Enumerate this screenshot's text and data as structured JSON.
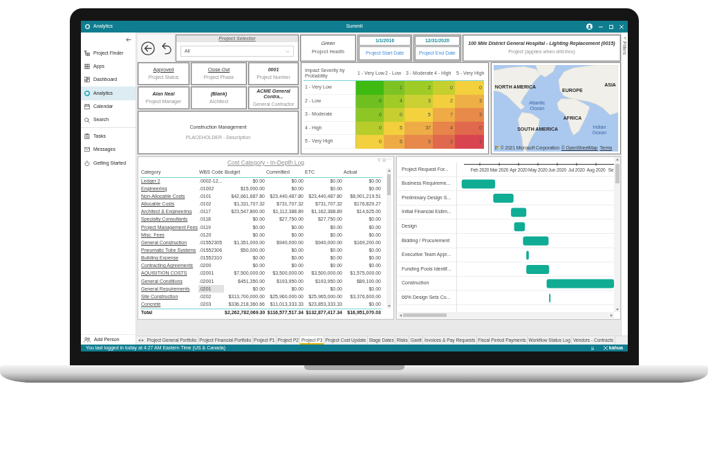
{
  "window": {
    "app_title": "Analytics",
    "title": "Summit"
  },
  "sidebar": {
    "groups": [
      [
        {
          "label": "Project Finder",
          "selected": false
        },
        {
          "label": "Apps",
          "selected": false
        },
        {
          "label": "Dashboard",
          "selected": false
        },
        {
          "label": "Analytics",
          "selected": true
        },
        {
          "label": "Calendar",
          "selected": false
        },
        {
          "label": "Search",
          "selected": false
        }
      ],
      [
        {
          "label": "Tasks",
          "selected": false
        },
        {
          "label": "Messages",
          "selected": false
        },
        {
          "label": "Getting Started",
          "selected": false
        }
      ]
    ],
    "footer_item": {
      "label": "Add Person"
    }
  },
  "project_selector": {
    "title": "Project Selector",
    "value": "All"
  },
  "kpis": [
    {
      "kind": "status",
      "value": "Green",
      "label": "Project Health"
    },
    {
      "kind": "date",
      "value": "1/1/2016",
      "label": "Project Start Date"
    },
    {
      "kind": "date",
      "value": "12/31/2020",
      "label": "Project End Date"
    },
    {
      "kind": "project",
      "value": "100 Mile District General Hospital - Lighting Replacement (0015)",
      "label": "Project (applies when drill-thru)"
    }
  ],
  "filters_pane": {
    "label": "Filters"
  },
  "project_cards": [
    {
      "kind": "link",
      "value": "Approved",
      "label": "Project Status"
    },
    {
      "kind": "link",
      "value": "Close-Out",
      "label": "Project Phase"
    },
    {
      "kind": "field",
      "value": "0001",
      "label": "Project Number"
    },
    {
      "kind": "field",
      "value": "Alan Neal",
      "label": "Project Manager"
    },
    {
      "kind": "field",
      "value": "(Blank)",
      "label": "Architect"
    },
    {
      "kind": "field",
      "value": "ACME General Contra...",
      "label": "General Contractor"
    }
  ],
  "description_card": {
    "title": "Construction Management",
    "subtitle": "PLACEHOLDER - Description"
  },
  "risk_matrix": {
    "title": "Impact Severity by Probability",
    "columns": [
      "1 - Very Low",
      "2 - Low",
      "3 - Moderate",
      "4 - High",
      "5 - Very High"
    ],
    "rows": [
      {
        "label": "1 - Very Low",
        "cells": [
          {
            "color": "#3fba12"
          },
          {
            "value": "1",
            "color": "#7ec324"
          },
          {
            "value": "2",
            "color": "#9fcb26"
          },
          {
            "value": "0",
            "color": "#c5cf2e"
          },
          {
            "value": "0",
            "color": "#f3d03c"
          }
        ]
      },
      {
        "label": "2 - Low",
        "cells": [
          {
            "value": "0",
            "color": "#6fbf20"
          },
          {
            "value": "4",
            "color": "#a0cb27"
          },
          {
            "value": "3",
            "color": "#cbd033"
          },
          {
            "value": "2",
            "color": "#f3cf3d"
          },
          {
            "value": "3",
            "color": "#eeb046"
          }
        ]
      },
      {
        "label": "3 - Moderate",
        "cells": [
          {
            "value": "0",
            "color": "#8ec626"
          },
          {
            "value": "0",
            "color": "#c6cf2f"
          },
          {
            "value": "5",
            "color": "#f4d13e"
          },
          {
            "value": "7",
            "color": "#efab46"
          },
          {
            "value": "3",
            "color": "#e78a4a"
          }
        ]
      },
      {
        "label": "4 - High",
        "cells": [
          {
            "value": "0",
            "color": "#b8cd2c"
          },
          {
            "value": "5",
            "color": "#f3cf3d"
          },
          {
            "value": "37",
            "color": "#eeac46"
          },
          {
            "value": "4",
            "color": "#e7844a"
          },
          {
            "value": "0",
            "color": "#e0684c"
          }
        ]
      },
      {
        "label": "5 - Very High",
        "cells": [
          {
            "value": "0",
            "color": "#f3d03d"
          },
          {
            "value": "5",
            "color": "#eeab45"
          },
          {
            "value": "3",
            "color": "#e6894a"
          },
          {
            "value": "2",
            "color": "#e0684c"
          },
          {
            "value": "1",
            "color": "#d8444f"
          }
        ]
      }
    ]
  },
  "map": {
    "labels": [
      {
        "text": "NORTH AMERICA",
        "kind": "continent"
      },
      {
        "text": "EUROPE",
        "kind": "continent"
      },
      {
        "text": "ASIA",
        "kind": "continent"
      },
      {
        "text": "Atlantic Ocean",
        "kind": "ocean"
      },
      {
        "text": "AFRICA",
        "kind": "continent"
      },
      {
        "text": "SOUTH AMERICA",
        "kind": "continent"
      },
      {
        "text": "Indian Ocean",
        "kind": "ocean"
      }
    ],
    "attribution": [
      "© 2021 Microsoft Corporation",
      "© OpenStreetMap",
      "Terms"
    ]
  },
  "cost_log": {
    "title": "Cost Category - In-Depth Log",
    "columns": [
      "Category",
      "WBS Code",
      "Budget",
      "Committed",
      "ETC",
      "Actual"
    ],
    "rows": [
      {
        "category": "Ledger 2",
        "wbs": ".0002-12...",
        "values": [
          "$0.00",
          "$0.00",
          "$0.00",
          "$0.00"
        ],
        "selected": false
      },
      {
        "category": "Engineering",
        "wbs": ".01002",
        "values": [
          "$15,000.00",
          "$0.00",
          "$0.00",
          "$0.00"
        ],
        "selected": false
      },
      {
        "category": "Non-Allocable Costs",
        "wbs": ".0101",
        "values": [
          "$42,661,687.80",
          "$23,440,487.80",
          "$23,440,487.80",
          "$8,901,219.51"
        ],
        "selected": false
      },
      {
        "category": "Allocable Costs",
        "wbs": ".0102",
        "values": [
          "$1,331,707.32",
          "$731,707.32",
          "$731,707.32",
          "$176,829.27"
        ],
        "selected": false
      },
      {
        "category": "Architect & Engineering",
        "wbs": ".0117",
        "values": [
          "$23,547,800.00",
          "$1,112,388.89",
          "$1,162,388.89",
          "$14,625.00"
        ],
        "selected": false
      },
      {
        "category": "Specialty Consultants",
        "wbs": ".0118",
        "values": [
          "$0.00",
          "$27,750.00",
          "$27,750.00",
          "$0.00"
        ],
        "selected": false
      },
      {
        "category": "Project Management Fees",
        "wbs": ".0119",
        "values": [
          "$0.00",
          "$0.00",
          "$0.00",
          "$0.00"
        ],
        "selected": false
      },
      {
        "category": "Misc. Fees",
        "wbs": ".0120",
        "values": [
          "$0.00",
          "$0.00",
          "$0.00",
          "$0.00"
        ],
        "selected": false
      },
      {
        "category": "General Construction",
        "wbs": ".01552305",
        "values": [
          "$1,351,000.00",
          "$940,000.00",
          "$940,000.00",
          "$169,200.00"
        ],
        "selected": false
      },
      {
        "category": "Pneumatic Tube Systems",
        "wbs": ".01552306",
        "values": [
          "$50,000.00",
          "$0.00",
          "$0.00",
          "$0.00"
        ],
        "selected": false
      },
      {
        "category": "Building Expense",
        "wbs": ".01552310",
        "values": [
          "$0.00",
          "$0.00",
          "$0.00",
          "$0.00"
        ],
        "selected": false
      },
      {
        "category": "Contracting Agreements",
        "wbs": ".0200",
        "values": [
          "$0.00",
          "$0.00",
          "$0.00",
          "$0.00"
        ],
        "selected": false
      },
      {
        "category": "AQUISITION COSTS",
        "wbs": ".02001",
        "values": [
          "$7,500,000.00",
          "$3,500,000.00",
          "$3,500,000.00",
          "$1,575,000.00"
        ],
        "selected": false
      },
      {
        "category": "General Conditions",
        "wbs": ".02001",
        "values": [
          "$451,350.00",
          "$193,950.00",
          "$193,950.00",
          "$89,100.00"
        ],
        "selected": false
      },
      {
        "category": "General Requirements",
        "wbs": ".0201",
        "values": [
          "$0.00",
          "$0.00",
          "$0.00",
          "$0.00"
        ],
        "selected": true
      },
      {
        "category": "Site Construction",
        "wbs": ".0202",
        "values": [
          "$313,700,000.00",
          "$25,960,000.00",
          "$25,965,000.00",
          "$3,376,600.00"
        ],
        "selected": false
      },
      {
        "category": "Concrete",
        "wbs": ".0203",
        "values": [
          "$336,218,360.66",
          "$11,013,333.33",
          "$23,853,333.33",
          "$0.00"
        ],
        "selected": false
      }
    ],
    "total": {
      "label": "Total",
      "values": [
        "$2,262,782,069.30",
        "$116,577,517.34",
        "$132,877,417.34",
        "$16,951,070.03"
      ]
    }
  },
  "gantt": {
    "tasks": [
      {
        "name": "Project Request For..."
      },
      {
        "name": "Business Requireme..."
      },
      {
        "name": "Preliminary Design S..."
      },
      {
        "name": "Initial Financial Estim..."
      },
      {
        "name": "Design"
      },
      {
        "name": "Bidding / Procurement"
      },
      {
        "name": "Executive Team Appr..."
      },
      {
        "name": "Funding Pools Identif..."
      },
      {
        "name": "Construction"
      },
      {
        "name": "66% Design Sets Co..."
      }
    ],
    "axis_labels": [
      "Feb 2020",
      "Mar 2020",
      "Apr 2020",
      "May 2020",
      "Jun 2020",
      "Jul 2020",
      "Aug 2020",
      "Se"
    ]
  },
  "report_tabs": [
    {
      "label": "Project General Portfolio",
      "selected": false
    },
    {
      "label": "Project Financial Portfolio",
      "selected": false
    },
    {
      "label": "Project P1",
      "selected": false
    },
    {
      "label": "Project P2",
      "selected": false
    },
    {
      "label": "Project P3",
      "selected": true
    },
    {
      "label": "Project Cost Update",
      "selected": false
    },
    {
      "label": "Stage Dates",
      "selected": false
    },
    {
      "label": "Risks",
      "selected": false
    },
    {
      "label": "Gantt",
      "selected": false
    },
    {
      "label": "Invoices & Pay Requests",
      "selected": false
    },
    {
      "label": "Fiscal Period Payments",
      "selected": false
    },
    {
      "label": "Workflow Status Log",
      "selected": false
    },
    {
      "label": "Vendors - Contracts",
      "selected": false
    }
  ],
  "status_bar": {
    "message": "You last logged in today at 4:27 AM Eastern Time (US & Canada)",
    "brand": "kahua"
  }
}
